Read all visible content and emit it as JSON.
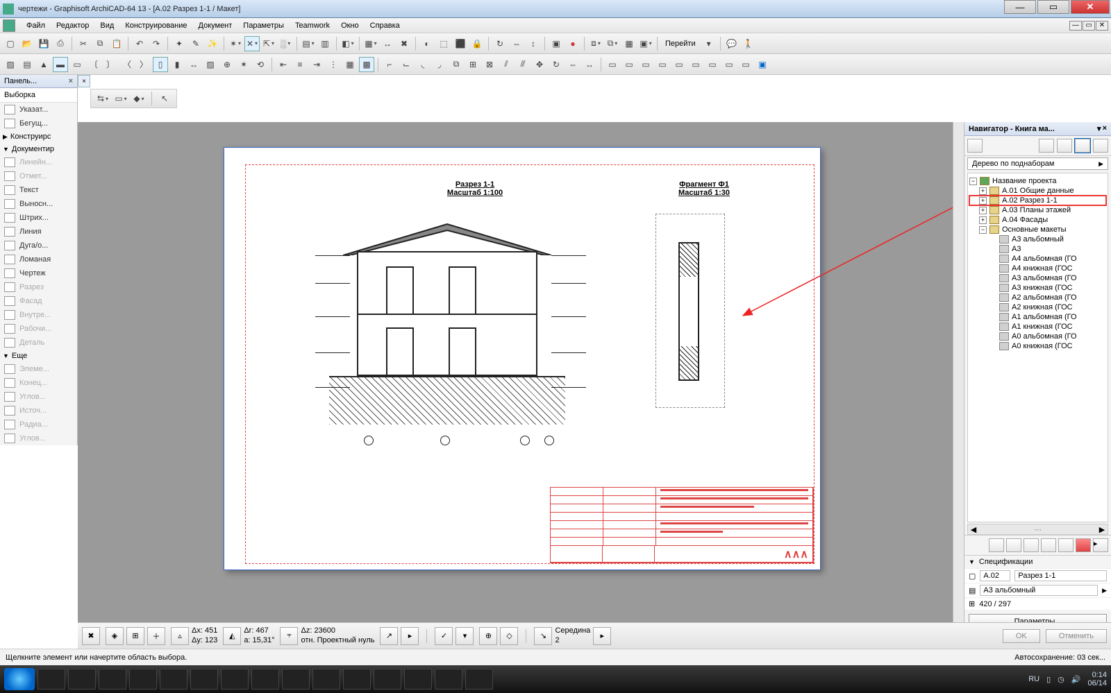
{
  "window": {
    "title": "чертежи - Graphisoft ArchiCAD-64 13 - [A.02 Разрез 1-1 / Макет]"
  },
  "menu": [
    "Файл",
    "Редактор",
    "Вид",
    "Конструирование",
    "Документ",
    "Параметры",
    "Teamwork",
    "Окно",
    "Справка"
  ],
  "toolbar_goto": "Перейти",
  "toolbox": {
    "panel_title": "Панель...",
    "section_selection": "Выборка",
    "arrow": "Указат...",
    "marquee": "Бегущ...",
    "cat_design": "Конструирс",
    "cat_document": "Документир",
    "tools": [
      {
        "label": "Линейн...",
        "disabled": true
      },
      {
        "label": "Отмет...",
        "disabled": true
      },
      {
        "label": "Текст",
        "disabled": false
      },
      {
        "label": "Выносн...",
        "disabled": false
      },
      {
        "label": "Штрих...",
        "disabled": false
      },
      {
        "label": "Линия",
        "disabled": false
      },
      {
        "label": "Дуга/о...",
        "disabled": false
      },
      {
        "label": "Ломаная",
        "disabled": false
      },
      {
        "label": "Чертеж",
        "disabled": false
      },
      {
        "label": "Разрез",
        "disabled": true
      },
      {
        "label": "Фасад",
        "disabled": true
      },
      {
        "label": "Внутре...",
        "disabled": true
      },
      {
        "label": "Рабочи...",
        "disabled": true
      },
      {
        "label": "Деталь",
        "disabled": true
      }
    ],
    "cat_more": "Еще",
    "more": [
      "Элеме...",
      "Конец...",
      "Углов...",
      "Источ...",
      "Радиа...",
      "Углов..."
    ]
  },
  "drawing": {
    "title1_line1": "Разрез 1-1",
    "title1_line2": "Масштаб 1:100",
    "title2_line1": "Фрагмент Ф1",
    "title2_line2": "Масштаб 1:30"
  },
  "navigator": {
    "title": "Навигатор - Книга ма...",
    "dropdown": "Дерево по поднаборам",
    "root": "Название проекта",
    "items": [
      {
        "label": "A.01 Общие данные",
        "sel": false
      },
      {
        "label": "A.02 Разрез 1-1",
        "sel": true
      },
      {
        "label": "A.03 Планы этажей",
        "sel": false
      },
      {
        "label": "A.04 Фасады",
        "sel": false
      }
    ],
    "masters_label": "Основные макеты",
    "masters": [
      "А3 альбомный",
      "А3",
      "А4 альбомная (ГО",
      "А4 книжная (ГОС",
      "А3 альбомная (ГО",
      "А3 книжная (ГОС",
      "А2 альбомная (ГО",
      "А2 книжная (ГОС",
      "А1 альбомная (ГО",
      "А1 книжная (ГОС",
      "А0 альбомная (ГО",
      "А0 книжная (ГОС"
    ],
    "spec_title": "Спецификации",
    "id": "A.02",
    "name": "Разрез 1-1",
    "master": "А3 альбомный",
    "size": "420 / 297",
    "params_btn": "Параметры..."
  },
  "coords": {
    "dx": "Δx: 451",
    "dy": "Δy: 123",
    "dr": "Δr: 467",
    "da": "a: 15,31°",
    "dz": "Δz: 23600",
    "ref": "отн. Проектный нуль",
    "side": "Середина",
    "side_n": "2",
    "ok": "OK",
    "cancel": "Отменить"
  },
  "status": {
    "hint": "Щелкните элемент или начертите область выбора.",
    "autosave": "Автосохранение: 03 сек..."
  },
  "taskbar": {
    "lang": "RU",
    "time": "0:14",
    "date": "06/14"
  }
}
